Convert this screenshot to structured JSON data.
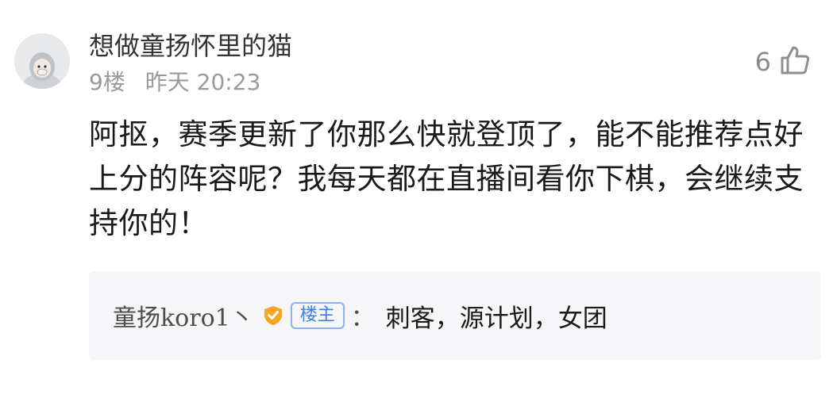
{
  "comment": {
    "username": "想做童扬怀里的猫",
    "floor": "9楼",
    "time": "昨天 20:23",
    "like_count": "6",
    "content": "阿抠，赛季更新了你那么快就登顶了，能不能推荐点好上分的阵容呢？我每天都在直播间看你下棋，会继续支持你的！"
  },
  "reply": {
    "author": "童扬koro1丶",
    "op_tag": "楼主",
    "colon": "：",
    "text": "刺客，源计划，女团"
  },
  "icons": {
    "like": "thumbs-up-icon",
    "verified": "verified-shield-icon",
    "avatar": "user-avatar"
  },
  "colors": {
    "op_tag_text": "#3f7fd9",
    "op_tag_border": "#8fb2e8",
    "verified_badge": "#f5a623",
    "reply_background": "#f6f6f8",
    "meta_text": "#9a9a9a"
  }
}
